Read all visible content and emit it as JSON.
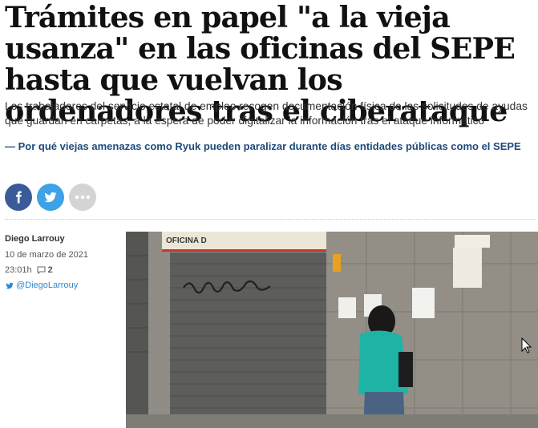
{
  "article": {
    "headline": "Trámites en papel \"a la vieja usanza\" en las oficinas del SEPE hasta que vuelvan los ordenadores tras el ciberataque",
    "subtitle": "Los trabajadores del servicio estatal de empleo recogen documentación física de las solicitudes de ayudas que guardan en carpetas, a la espera de poder digitalizar la información tras el ataque informático",
    "related": "— Por qué viejas amenazas como Ryuk pueden paralizar durante días entidades públicas como el SEPE"
  },
  "share": {
    "facebook_icon": "facebook-icon",
    "twitter_icon": "twitter-icon",
    "more_icon": "more-dots-icon",
    "colors": {
      "facebook": "#3b5a9a",
      "twitter": "#3fa1e6",
      "more": "#d4d4d4"
    }
  },
  "byline": {
    "author": "Diego Larrouy",
    "date": "10 de marzo de 2021",
    "time": "23:01h",
    "comments": "2",
    "twitter_handle": "@DiegoLarrouy"
  },
  "photo": {
    "sign_text": "OFICINA D",
    "description_colors": {
      "shutter": "#5d5e5c",
      "wall": "#8f8d86",
      "shirt": "#1fb3a6"
    }
  }
}
